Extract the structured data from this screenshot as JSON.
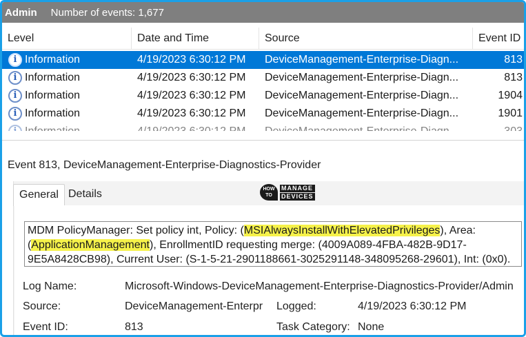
{
  "header": {
    "log_name": "Admin",
    "event_count": "Number of events: 1,677"
  },
  "grid": {
    "columns": [
      "Level",
      "Date and Time",
      "Source",
      "Event ID"
    ],
    "rows": [
      {
        "level": "Information",
        "date": "4/19/2023 6:30:12 PM",
        "source": "DeviceManagement-Enterprise-Diagn...",
        "event_id": "813",
        "selected": true
      },
      {
        "level": "Information",
        "date": "4/19/2023 6:30:12 PM",
        "source": "DeviceManagement-Enterprise-Diagn...",
        "event_id": "813"
      },
      {
        "level": "Information",
        "date": "4/19/2023 6:30:12 PM",
        "source": "DeviceManagement-Enterprise-Diagn...",
        "event_id": "1904"
      },
      {
        "level": "Information",
        "date": "4/19/2023 6:30:12 PM",
        "source": "DeviceManagement-Enterprise-Diagn...",
        "event_id": "1901"
      },
      {
        "level": "Information",
        "date": "4/19/2023 6:30:12 PM",
        "source": "DeviceManagement-Enterprise-Diagn...",
        "event_id": "303"
      }
    ]
  },
  "details": {
    "event_title": "Event 813, DeviceManagement-Enterprise-Diagnostics-Provider",
    "tabs": {
      "general": "General",
      "details": "Details"
    },
    "logo": {
      "how": "HOW TO",
      "line1": "MANAGE",
      "line2": "DEVICES"
    },
    "message": {
      "part1": "MDM PolicyManager: Set policy int, Policy: (",
      "policy": "MSIAlwaysInstallWithElevatedPrivileges",
      "part2": "), Area: (",
      "area": "ApplicationManagement",
      "part3": "), EnrollmentID requesting merge: (4009A089-4FBA-482B-9D17-9E5A8428CB98), Current User: (S-1-5-21-2901188661-3025291148-348095268-29601), Int: (0x0)."
    },
    "fields": {
      "log_name_label": "Log Name:",
      "log_name_value": "Microsoft-Windows-DeviceManagement-Enterprise-Diagnostics-Provider/Admin",
      "source_label": "Source:",
      "source_value": "DeviceManagement-Enterpr",
      "logged_label": "Logged:",
      "logged_value": "4/19/2023 6:30:12 PM",
      "event_id_label": "Event ID:",
      "event_id_value": "813",
      "task_category_label": "Task Category:",
      "task_category_value": "None"
    }
  },
  "colors": {
    "selection": "#0078d7",
    "highlight": "#f6f24a",
    "frame": "#1aa0e8"
  }
}
